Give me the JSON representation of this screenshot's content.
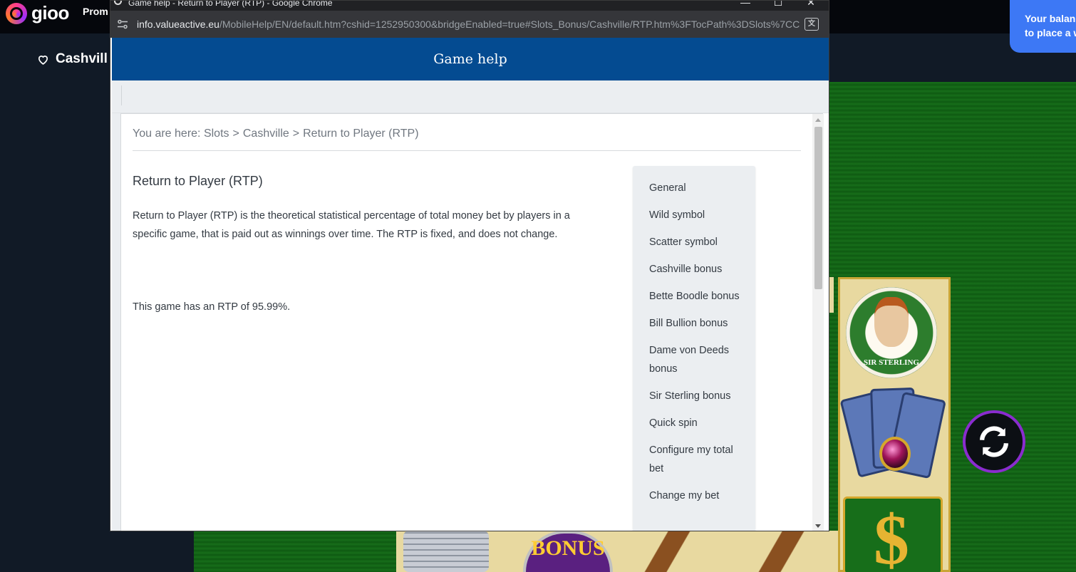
{
  "site": {
    "brand": "gioo",
    "nav_label": "Prom",
    "game_title": "Cashvill",
    "balance_toast": [
      "Your balan",
      "to place a w"
    ],
    "sterling_label": "SIR STERLING",
    "bonus_label": "BONUS",
    "dollar_glyph": "$"
  },
  "window": {
    "title": "Game help - Return to Player (RTP) - Google Chrome",
    "minimize": "—",
    "maximize": "☐",
    "close": "✕"
  },
  "urlbar": {
    "domain": "info.valueactive.eu",
    "path": "/MobileHelp/EN/default.htm?cshid=1252950300&bridgeEnabled=true#Slots_Bonus/Cashville/RTP.htm%3FTocPath%3DSlots%7CCa..."
  },
  "help": {
    "header": "Game help",
    "breadcrumb_prefix": "You are here:",
    "breadcrumb": [
      "Slots",
      "Cashville",
      "Return to Player (RTP)"
    ],
    "breadcrumb_separator": ">",
    "title": "Return to Player (RTP)",
    "paragraph": "Return to Player (RTP) is the theoretical statistical percentage of total money bet by players in a specific game, that is paid out as winnings over time. The RTP is fixed, and does not change.",
    "rtp_statement": "This game has an RTP of 95.99%.",
    "toc": [
      "General",
      "Wild symbol",
      "Scatter symbol",
      "Cashville bonus",
      "Bette Boodle bonus",
      "Bill Bullion bonus",
      "Dame von Deeds bonus",
      "Sir Sterling bonus",
      "Quick spin",
      "Configure my total bet",
      "Change my bet"
    ]
  },
  "colors": {
    "header_blue": "#044b91",
    "toast_blue": "#3d78f5",
    "felt_green": "#176e1a",
    "spin_ring": "#8a2ccf"
  },
  "icons": [
    "heart-icon",
    "refresh-spin-icon",
    "site-tune-icon",
    "translate-icon",
    "chrome-icon"
  ]
}
